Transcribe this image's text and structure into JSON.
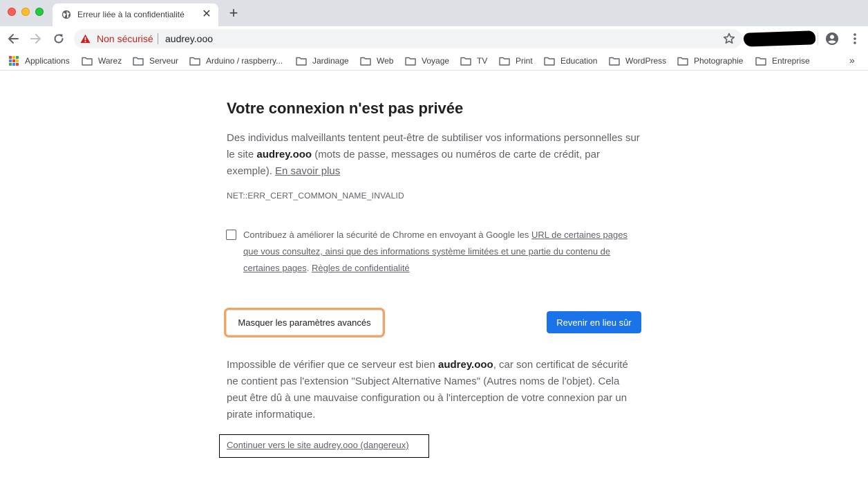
{
  "tab": {
    "title": "Erreur liée à la confidentialité",
    "close_label": "✕",
    "new_tab_label": "+"
  },
  "toolbar": {
    "security_label": "Non sécurisé",
    "url": "audrey.ooo"
  },
  "bookmarks": {
    "apps_label": "Applications",
    "folders": [
      "Warez",
      "Serveur",
      "Arduino / raspberry...",
      "Jardinage",
      "Web",
      "Voyage",
      "TV",
      "Print",
      "Education",
      "WordPress",
      "Photographie",
      "Entreprise"
    ],
    "more_label": "»"
  },
  "page": {
    "heading": "Votre connexion n'est pas privée",
    "intro_before": "Des individus malveillants tentent peut-être de subtiliser vos informations personnelles sur le site ",
    "intro_site": "audrey.ooo",
    "intro_after": " (mots de passe, messages ou numéros de carte de crédit, par exemple). ",
    "learn_more": "En savoir plus",
    "error_code": "NET::ERR_CERT_COMMON_NAME_INVALID",
    "optin_before": "Contribuez à améliorer la sécurité de Chrome en envoyant à Google les ",
    "optin_link": "URL de certaines pages que vous consultez, ainsi que des informations système limitées et une partie du contenu de certaines pages",
    "optin_middle": ". ",
    "privacy_link": "Règles de confidentialité",
    "advanced_button": "Masquer les paramètres avancés",
    "safe_button": "Revenir en lieu sûr",
    "details_before": "Impossible de vérifier que ce serveur est bien ",
    "details_site": "audrey.ooo",
    "details_after": ", car son certificat de sécurité ne contient pas l'extension \"Subject Alternative Names\" (Autres noms de l'objet). Cela peut être dû à une mauvaise configuration ou à l'interception de votre connexion par un pirate informatique.",
    "proceed_link": "Continuer vers le site audrey.ooo (dangereux)"
  },
  "colors": {
    "tabstrip": "#dee1e6",
    "not_secure": "#c5221f",
    "primary_button": "#1a73e8",
    "focus_ring": "#f4a461",
    "body_text": "#5f6368"
  },
  "icons": {
    "tab_favicon": "globe-icon",
    "security": "warning-triangle-icon",
    "bookmark_star": "star-icon",
    "profile": "account-circle-icon",
    "menu": "more-vertical-icon",
    "folder": "folder-icon",
    "apps": "apps-grid-icon"
  }
}
